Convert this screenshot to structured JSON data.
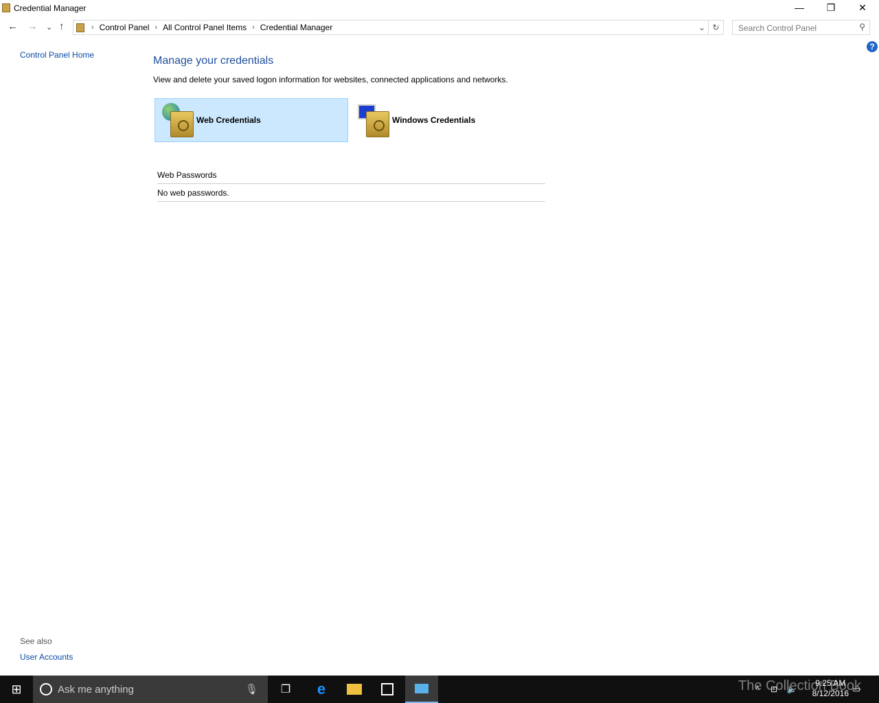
{
  "window": {
    "title": "Credential Manager",
    "minimize": "—",
    "restore": "❐",
    "close": "✕"
  },
  "nav": {
    "back": "←",
    "forward": "→",
    "recent": "⌄",
    "up": "↑",
    "dropdown": "⌄",
    "refresh": "↻"
  },
  "breadcrumb": [
    "Control Panel",
    "All Control Panel Items",
    "Credential Manager"
  ],
  "search": {
    "placeholder": "Search Control Panel",
    "icon": "⚲"
  },
  "help": "?",
  "sidebar": {
    "home": "Control Panel Home",
    "see_also": "See also",
    "user_accounts": "User Accounts"
  },
  "main": {
    "heading": "Manage your credentials",
    "description": "View and delete your saved logon information for websites, connected applications and networks.",
    "tiles": [
      {
        "label": "Web Credentials",
        "selected": true
      },
      {
        "label": "Windows Credentials",
        "selected": false
      }
    ],
    "section_title": "Web Passwords",
    "empty_text": "No web passwords."
  },
  "taskbar": {
    "search_placeholder": "Ask me anything",
    "time": "9:25 AM",
    "date": "8/12/2016",
    "watermark": "The Collection Book"
  }
}
